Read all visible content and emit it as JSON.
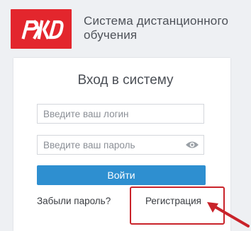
{
  "header": {
    "title_line1": "Система дистанционного",
    "title_line2": "обучения",
    "logo_color": "#e3262d"
  },
  "login": {
    "heading": "Вход в систему",
    "login_placeholder": "Введите ваш логин",
    "password_placeholder": "Введите ваш пароль",
    "submit_label": "Войти",
    "forgot_label": "Забыли пароль?",
    "register_label": "Регистрация",
    "accent_color": "#2e8fd0",
    "highlight_color": "#c9232a"
  },
  "icons": {
    "logo": "rzd-logo-icon",
    "password_toggle": "eye-icon",
    "annotation_arrow": "arrow-icon"
  }
}
